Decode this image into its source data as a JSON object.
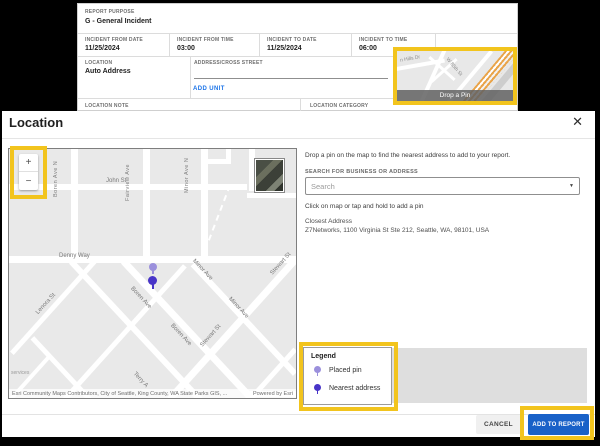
{
  "colors": {
    "highlight_yellow": "#F2C41D",
    "primary_blue": "#1961C8",
    "link_blue": "#1A73E8",
    "placed_pin": "#9B90DC",
    "nearest_pin": "#4834C8"
  },
  "form": {
    "report_purpose": {
      "label": "REPORT PURPOSE",
      "value": "G - General Incident"
    },
    "fields": [
      {
        "label": "INCIDENT FROM DATE",
        "value": "11/25/2024"
      },
      {
        "label": "INCIDENT FROM TIME",
        "value": "03:00"
      },
      {
        "label": "INCIDENT TO DATE",
        "value": "11/25/2024"
      },
      {
        "label": "INCIDENT TO TIME",
        "value": "06:00"
      }
    ],
    "location": {
      "label": "LOCATION",
      "value": "Auto Address"
    },
    "address": {
      "label": "ADDRESS/CROSS STREET",
      "value": ""
    },
    "add_unit_label": "ADD UNIT",
    "location_note_label": "LOCATION NOTE",
    "location_category_label": "LOCATION CATEGORY",
    "minimap": {
      "drop_pin_label": "Drop a Pin",
      "street_labels": [
        {
          "text": "n Hills Dr"
        },
        {
          "text": "W 85th St"
        }
      ]
    }
  },
  "modal": {
    "title": "Location",
    "close_icon": "✕",
    "intro": "Drop a pin on the map to find the nearest address to add to your report.",
    "search": {
      "label": "SEARCH FOR BUSINESS OR ADDRESS",
      "placeholder": "Search",
      "caret_icon": "▼"
    },
    "hint": "Click on map or tap and hold to add a pin",
    "closest_address": {
      "label": "Closest Address",
      "value": "Z7Networks, 1100 Virginia St Ste 212, Seattle, WA, 98101, USA"
    },
    "legend": {
      "title": "Legend",
      "items": [
        {
          "label": "Placed pin"
        },
        {
          "label": "Nearest address"
        }
      ]
    },
    "footer": {
      "cancel_label": "CANCEL",
      "add_label": "ADD TO REPORT"
    }
  },
  "map": {
    "zoom_in_label": "+",
    "zoom_out_label": "−",
    "vertical_labels": [
      {
        "text": "Boren Ave N"
      },
      {
        "text": "Fairview Ave"
      },
      {
        "text": "Minor Ave N"
      }
    ],
    "street_labels": [
      {
        "text": "John St"
      },
      {
        "text": "Denny Way"
      },
      {
        "text": "Lenora St"
      },
      {
        "text": "Boren Ave"
      },
      {
        "text": "Boren Ave"
      },
      {
        "text": "Minor Ave"
      },
      {
        "text": "Minor Ave"
      },
      {
        "text": "Stewart St"
      },
      {
        "text": "Stewart St"
      },
      {
        "text": "Terry A"
      },
      {
        "text": "services"
      }
    ],
    "attribution": "Esri Community Maps Contributors, City of Seattle, King County, WA State Parks GIS, ...",
    "powered_by": "Powered by Esri"
  }
}
